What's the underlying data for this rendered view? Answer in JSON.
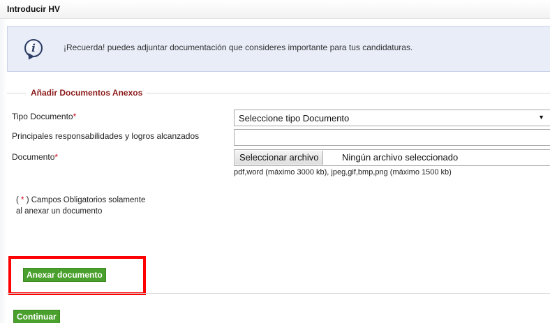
{
  "header": {
    "title": "Introducir HV"
  },
  "info": {
    "icon": "info-icon",
    "icon_glyph": "i",
    "message": "¡Recuerda! puedes adjuntar documentación que consideres importante para tus candidaturas."
  },
  "section": {
    "legend": "Añadir Documentos Anexos"
  },
  "form": {
    "tipo_documento": {
      "label": "Tipo Documento",
      "required_mark": "*",
      "selected": "Seleccione tipo Documento",
      "arrow": "▼"
    },
    "responsabilidades": {
      "label": "Principales responsabilidades y logros alcanzados",
      "value": ""
    },
    "documento": {
      "label": "Documento",
      "required_mark": "*",
      "button_label": "Seleccionar archivo",
      "status": "Ningún archivo seleccionado",
      "hint": "pdf,word (máximo 3000 kb), jpeg,gif,bmp,png (máximo 1500 kb)"
    }
  },
  "note": {
    "open": "( ",
    "mark": "*",
    "line1_rest": " ) Campos Obligatorios solamente",
    "line2": "al anexar un documento"
  },
  "actions": {
    "anexar_label": "Anexar documento",
    "continuar_label": "Continuar"
  },
  "colors": {
    "accent_green": "#4aa02c",
    "legend_red": "#8b1a1a",
    "highlight_red": "#ff0000",
    "info_bg": "#e8edf8"
  }
}
